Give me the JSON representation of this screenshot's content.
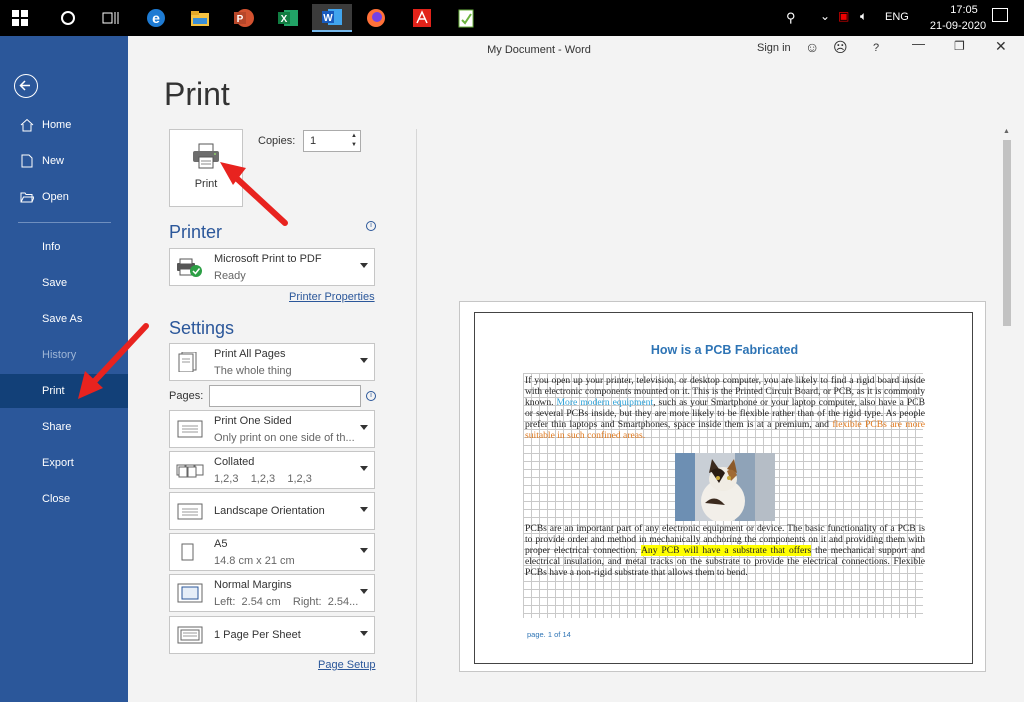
{
  "taskbar": {
    "lang": "ENG",
    "time": "17:05",
    "date": "21-09-2020",
    "apps": [
      "start-icon",
      "cortana-icon",
      "task-view-icon",
      "edge-icon",
      "file-explorer-icon",
      "powerpoint-icon",
      "excel-icon",
      "word-icon",
      "firefox-icon",
      "acrobat-icon",
      "notepad-icon"
    ]
  },
  "window": {
    "title": "My Document  -  Word",
    "signin": "Sign in",
    "help": "?"
  },
  "backstage": {
    "items": [
      {
        "label": "Home"
      },
      {
        "label": "New"
      },
      {
        "label": "Open"
      },
      {
        "label": "Info"
      },
      {
        "label": "Save"
      },
      {
        "label": "Save As"
      },
      {
        "label": "History"
      },
      {
        "label": "Print"
      },
      {
        "label": "Share"
      },
      {
        "label": "Export"
      },
      {
        "label": "Close"
      }
    ]
  },
  "print": {
    "heading": "Print",
    "button_label": "Print",
    "copies_label": "Copies:",
    "copies_value": "1",
    "printer_heading": "Printer",
    "printer_name": "Microsoft Print to PDF",
    "printer_status": "Ready",
    "printer_properties": "Printer Properties",
    "settings_heading": "Settings",
    "pages_label": "Pages:",
    "page_setup": "Page Setup",
    "settings": [
      {
        "t1": "Print All Pages",
        "t2": "The whole thing"
      },
      {
        "t1": "Print One Sided",
        "t2": "Only print on one side of th..."
      },
      {
        "t1": "Collated",
        "t2": "1,2,3    1,2,3    1,2,3"
      },
      {
        "t1": "Landscape Orientation",
        "t2": ""
      },
      {
        "t1": "A5",
        "t2": "14.8 cm x 21 cm"
      },
      {
        "t1": "Normal Margins",
        "t2": "Left:  2.54 cm    Right:  2.54..."
      },
      {
        "t1": "1 Page Per Sheet",
        "t2": ""
      }
    ]
  },
  "preview": {
    "doc_title": "How is a PCB Fabricated",
    "para1_a": "If you open up your printer, television, or desktop computer, you are likely to find a rigid board inside with electronic components mounted on it. This is the Printed Circuit Board, or PCB, as it is commonly known. ",
    "para1_blue": "More modern equipment",
    "para1_b": ", such as your Smartphone or your laptop computer, also have a PCB or several PCBs inside, but they are more likely to be flexible rather than of the rigid type. As people prefer thin laptops and Smartphones, space inside them is at a premium, and ",
    "para1_orange": "flexible PCBs are more suitable in such confined areas.",
    "para2_a": "PCBs are an important part of any electronic equipment or device. The basic functionality of a PCB is to provide order and method in mechanically anchoring the components on it and providing them with proper electrical connection. ",
    "para2_yellow": "Any PCB will have a substrate that offers",
    "para2_b": " the mechanical support and electrical insulation, and metal tracks on the substrate to provide the electrical connections. Flexible PCBs have a non-rigid substrate that allows them to bend.",
    "page_num": "page. 1 of 14"
  }
}
